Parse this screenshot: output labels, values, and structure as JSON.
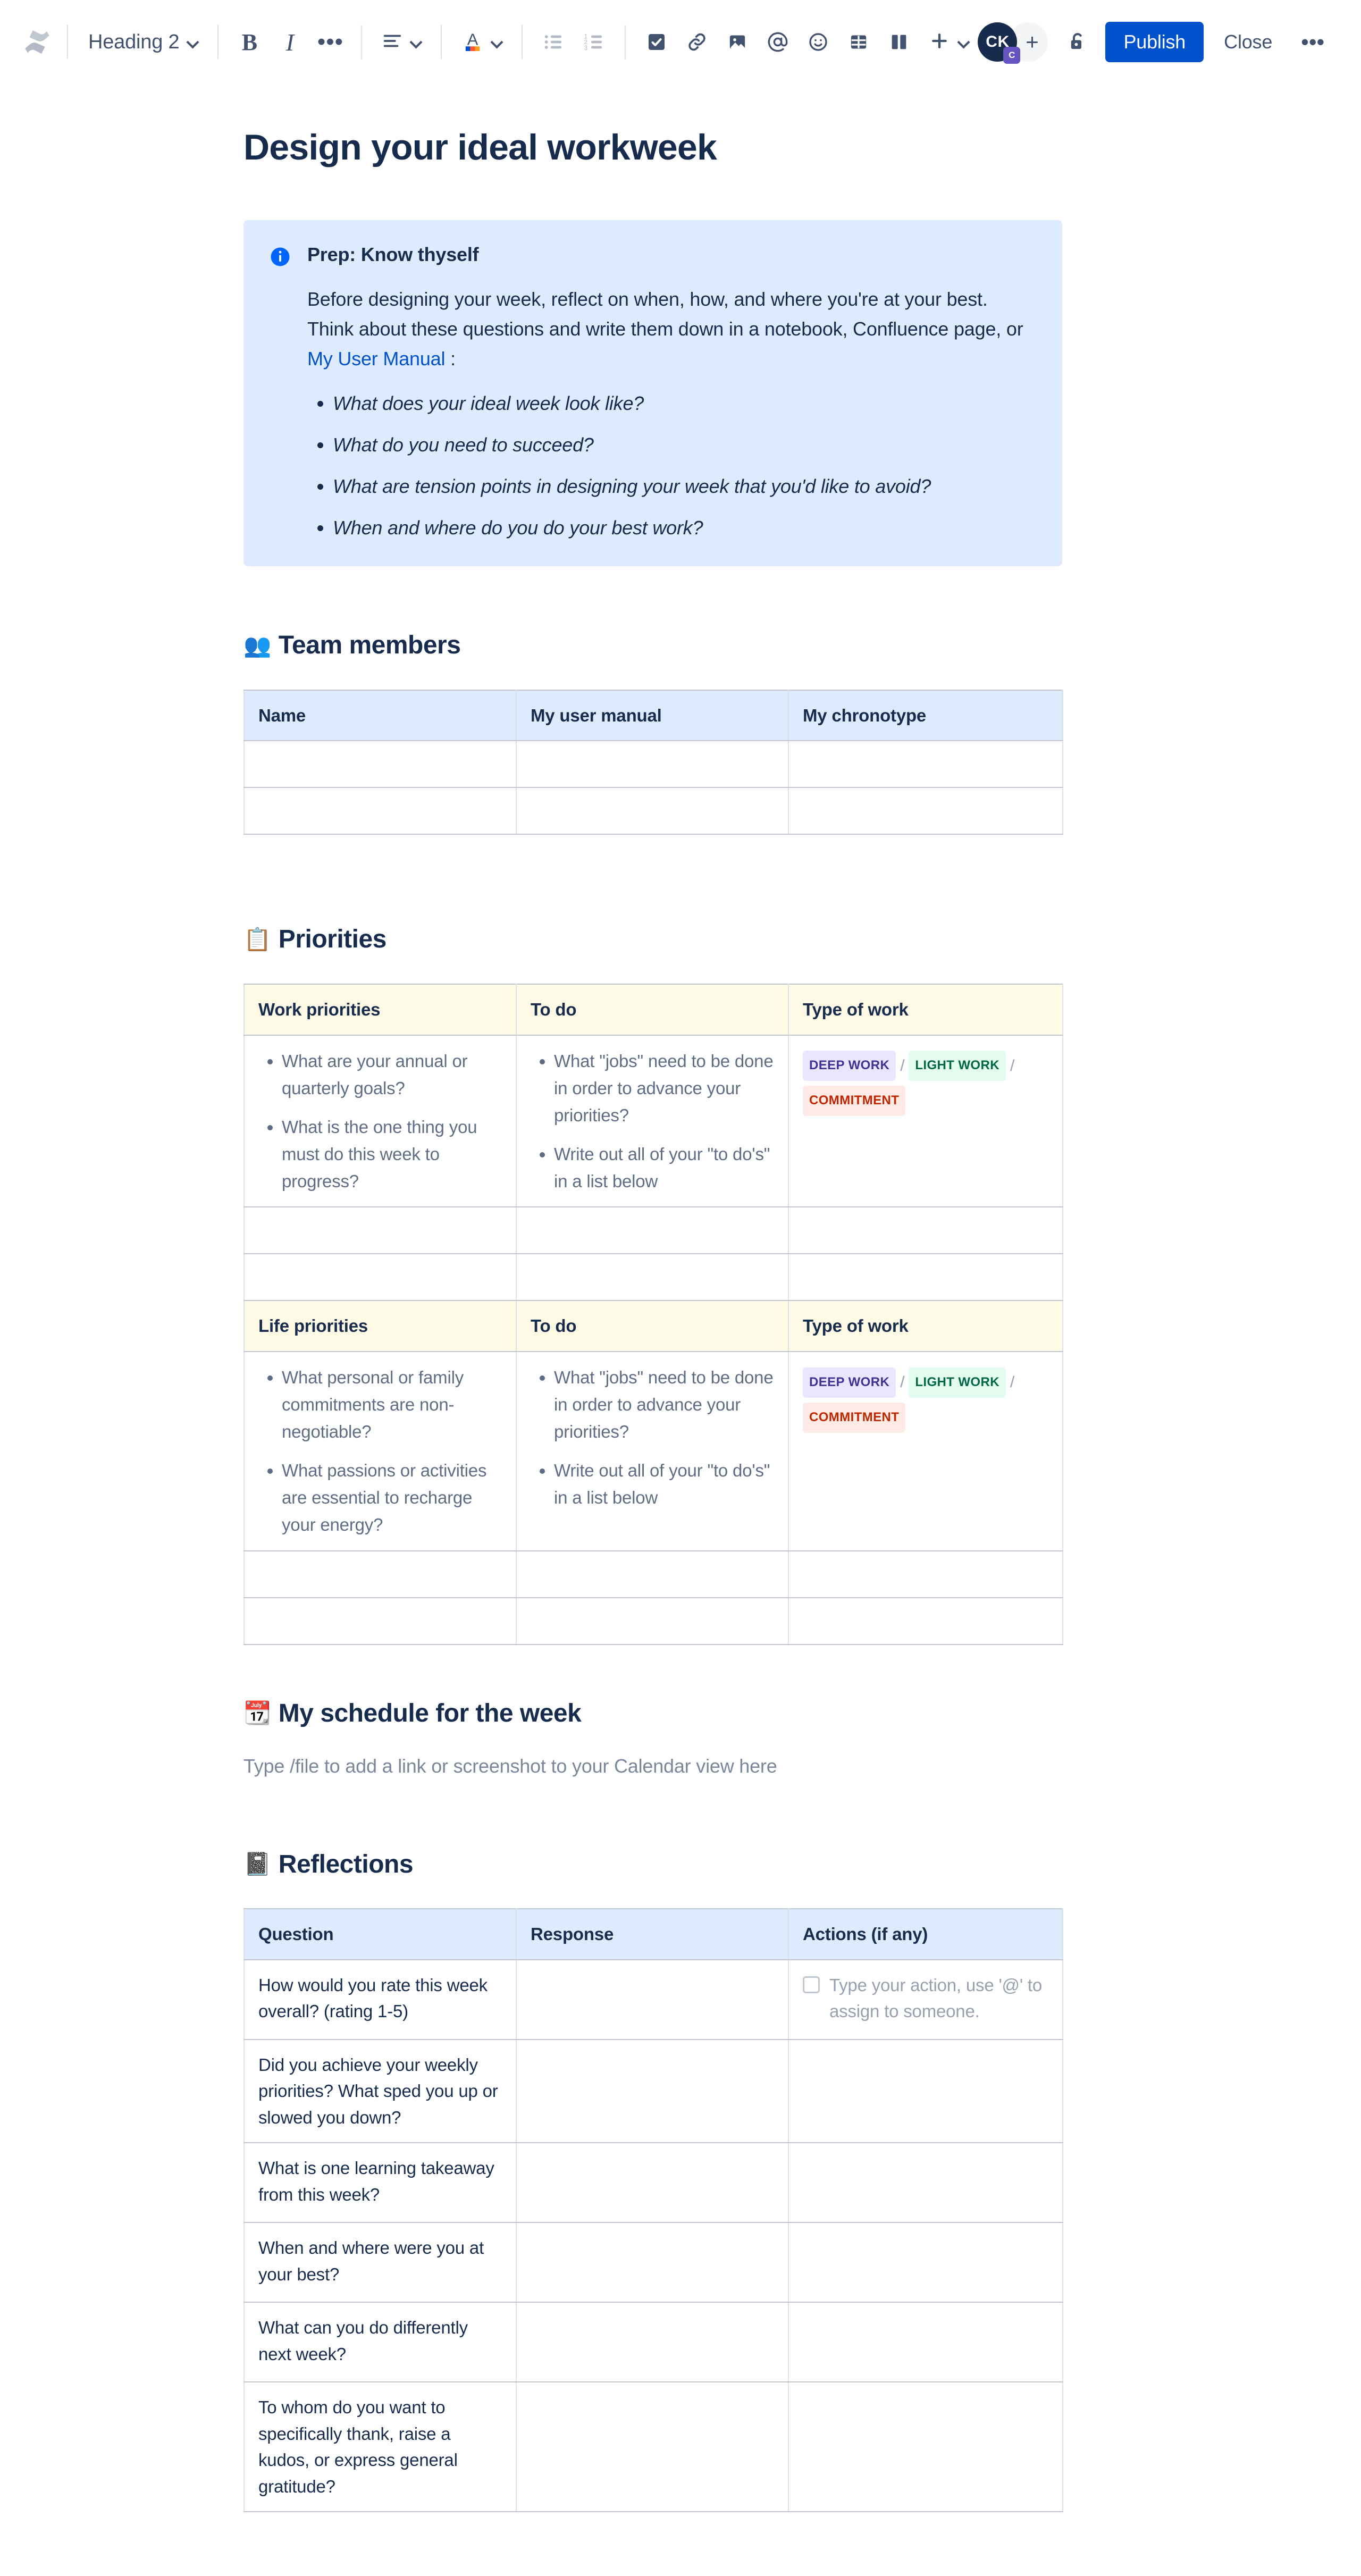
{
  "toolbar": {
    "logo_name": "confluence-logo",
    "style_select": {
      "value": "Heading 2",
      "name": "text-style-select"
    },
    "bold_label": "B",
    "italic_label": "I",
    "more_formatting_label": "•••",
    "buttons": [
      {
        "name": "text-align-button",
        "label": "align"
      },
      {
        "name": "text-color-button",
        "label": "A"
      },
      {
        "name": "bullet-list-button",
        "label": "bulleted list"
      },
      {
        "name": "numbered-list-button",
        "label": "numbered list"
      },
      {
        "name": "action-item-button",
        "label": "action item"
      },
      {
        "name": "link-button",
        "label": "link"
      },
      {
        "name": "image-button",
        "label": "image"
      },
      {
        "name": "mention-button",
        "label": "mention"
      },
      {
        "name": "emoji-button",
        "label": "emoji"
      },
      {
        "name": "table-button",
        "label": "table"
      },
      {
        "name": "layout-button",
        "label": "layout"
      },
      {
        "name": "insert-more-button",
        "label": "+"
      }
    ],
    "avatar_initials": "CK",
    "avatar_badge": "C",
    "invite_label": "+",
    "restrictions_name": "unlock-icon",
    "publish_label": "Publish",
    "close_label": "Close",
    "more_actions_label": "•••"
  },
  "document": {
    "title": "Design your ideal workweek",
    "info_panel": {
      "icon": "info-icon",
      "title": "Prep: Know thyself",
      "paragraph_before_link": "Before designing your week, reflect on when, how, and where you're at your best. Think about these questions and write them down in a notebook, Confluence page, or ",
      "link_text": "My User Manual",
      "paragraph_after_link": " :",
      "questions": [
        "What does your ideal week look like?",
        "What do you need to succeed?",
        "What are tension points in designing your week that you'd like to avoid?",
        "When and where do you do your best work?"
      ]
    },
    "sections": {
      "team_members": {
        "emoji": "👥",
        "emoji_name": "busts-in-silhouette-emoji",
        "heading": "Team members",
        "table": {
          "headers": [
            "Name",
            "My user manual",
            "My chronotype"
          ],
          "header_link_index": 2,
          "empty_rows": 2
        }
      },
      "priorities": {
        "emoji": "📋",
        "emoji_name": "clipboard-emoji",
        "heading": "Priorities",
        "work": {
          "headers": [
            "Work priorities",
            "To do",
            "Type of work"
          ],
          "col1_bullets": [
            "What are your annual or quarterly goals?",
            "What is the one thing you must do this week to progress?"
          ],
          "col2_bullets": [
            "What \"jobs\" need to be done in order to advance your priorities?",
            "Write out all of your \"to do's\" in a list below"
          ],
          "lozenges": [
            {
              "label": "DEEP WORK",
              "style": "purple"
            },
            {
              "label": "LIGHT WORK",
              "style": "green"
            },
            {
              "label": "COMMITMENT",
              "style": "red"
            }
          ],
          "empty_rows": 2
        },
        "life": {
          "headers": [
            "Life priorities",
            "To do",
            "Type of work"
          ],
          "col1_bullets": [
            "What personal or family commitments are non-negotiable?",
            "What passions or activities are essential to recharge your energy?"
          ],
          "col2_bullets": [
            "What \"jobs\" need to be done in order to advance your priorities?",
            "Write out all of your \"to do's\" in a list below"
          ],
          "lozenges": [
            {
              "label": "DEEP WORK",
              "style": "purple"
            },
            {
              "label": "LIGHT WORK",
              "style": "green"
            },
            {
              "label": "COMMITMENT",
              "style": "red"
            }
          ],
          "empty_rows": 2
        }
      },
      "schedule": {
        "emoji": "📆",
        "emoji_name": "calendar-emoji",
        "heading": "My schedule for the week",
        "placeholder": "Type /file to add a link or screenshot to your Calendar view here"
      },
      "reflections": {
        "emoji": "📓",
        "emoji_name": "notebook-emoji",
        "heading": "Reflections",
        "table": {
          "headers": [
            "Question",
            "Response",
            "Actions (if any)"
          ],
          "rows": [
            {
              "question": "How would you rate this week overall? (rating 1-5)",
              "response": "",
              "action_placeholder": "Type your action, use '@' to assign to someone.",
              "has_action": true
            },
            {
              "question": "Did you achieve your weekly priorities? What sped you up or slowed you down?",
              "response": "",
              "action_placeholder": "",
              "has_action": false
            },
            {
              "question": "What is one learning takeaway from this week?",
              "response": "",
              "action_placeholder": "",
              "has_action": false
            },
            {
              "question": "When and where were you at your best?",
              "response": "",
              "action_placeholder": "",
              "has_action": false
            },
            {
              "question": "What can you do differently next week?",
              "response": "",
              "action_placeholder": "",
              "has_action": false
            },
            {
              "question": "To whom do you want to specifically thank, raise a kudos, or express general gratitude?",
              "response": "",
              "action_placeholder": "",
              "has_action": false
            }
          ]
        }
      }
    }
  },
  "colors": {
    "brand_blue": "#0052cc",
    "panel_blue": "#deebff",
    "header_cream": "#fffae6",
    "text_primary": "#172b4d",
    "text_muted": "#5e6c84",
    "placeholder": "#7a869a",
    "border": "#c1c7d0",
    "loz_purple_bg": "#eae6ff",
    "loz_purple_fg": "#403294",
    "loz_green_bg": "#e3fcef",
    "loz_green_fg": "#006644",
    "loz_red_bg": "#ffebe6",
    "loz_red_fg": "#bf2600"
  }
}
